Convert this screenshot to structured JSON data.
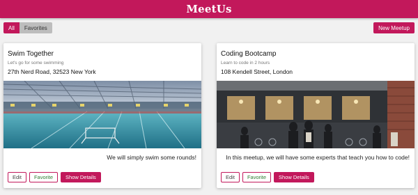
{
  "app": {
    "title": "MeetUs"
  },
  "toolbar": {
    "filter_all": "All",
    "filter_favorites": "Favorites",
    "new_meetup": "New Meetup"
  },
  "colors": {
    "primary": "#c2185b",
    "favorites_bg": "#bdbdbd",
    "favorite_text": "#2e7d32"
  },
  "meetups": [
    {
      "title": "Swim Together",
      "subtitle": "Let's go for some swimming",
      "address": "27th Nerd Road, 32523 New York",
      "image_desc": "indoor swimming pool",
      "description": "We will simply swim some rounds!",
      "buttons": {
        "edit": "Edit",
        "favorite": "Favorite",
        "details": "Show Details"
      }
    },
    {
      "title": "Coding Bootcamp",
      "subtitle": "Learn to code in 2 hours",
      "address": "108 Kendell Street, London",
      "image_desc": "cafe storefront with people",
      "description": "In this meetup, we will have some experts that teach you how to code!",
      "buttons": {
        "edit": "Edit",
        "favorite": "Favorite",
        "details": "Show Details"
      }
    }
  ]
}
